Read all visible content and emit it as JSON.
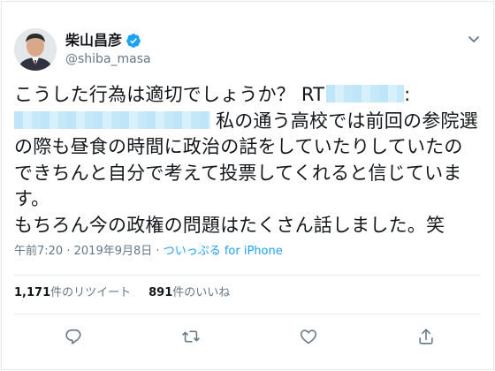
{
  "user": {
    "display_name": "柴山昌彦",
    "handle": "@shiba_masa",
    "verified": true
  },
  "tweet": {
    "line1_text": "こうした行為は適切でしょうか？ RT",
    "line1_tail": ":",
    "line2_text": "私の通う高校では前回の参院選",
    "line3_text": "の際も昼食の時間に政治の話をしていたりしていたの",
    "line4_text": "できちんと自分で考えて投票してくれると信じていま",
    "line5_text": "す。",
    "line6_text": "もちろん今の政権の問題はたくさん話しました。笑"
  },
  "meta": {
    "time": "午前7:20",
    "separator": "·",
    "date": "2019年9月8日",
    "source": "ついっぷる for iPhone"
  },
  "stats": {
    "retweet_count": "1,171",
    "retweet_label": "件のリツイート",
    "like_count": "891",
    "like_label": "件のいいね"
  },
  "actions": {
    "reply_icon": "reply-icon",
    "retweet_icon": "retweet-icon",
    "like_icon": "heart-icon",
    "share_icon": "share-icon"
  },
  "colors": {
    "accent": "#1da1f2",
    "text": "#14171a",
    "secondary": "#657786",
    "redaction": "#bfe6f8"
  }
}
